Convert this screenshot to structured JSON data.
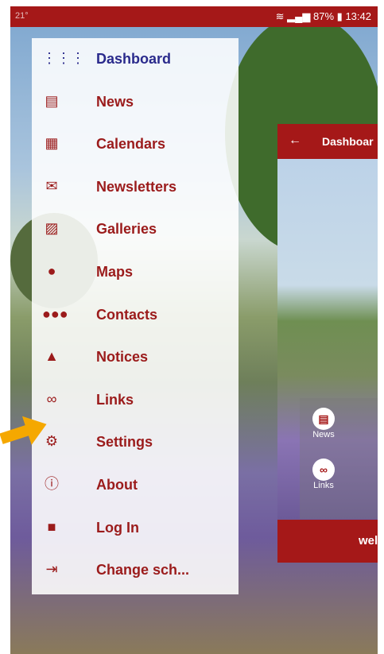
{
  "status": {
    "notification": "21°",
    "signal_battery": "87%",
    "time": "13:42"
  },
  "background_app": {
    "back_label": "←",
    "title": "Dashboar",
    "tile_news": "News",
    "tile_links": "Links",
    "welcome_partial": "wel"
  },
  "drawer": {
    "items": [
      {
        "label": "Dashboard",
        "icon": "dashboard-icon",
        "glyph": "⋮⋮⋮"
      },
      {
        "label": "News",
        "icon": "news-icon",
        "glyph": "▤"
      },
      {
        "label": "Calendars",
        "icon": "calendar-icon",
        "glyph": "▦"
      },
      {
        "label": "Newsletters",
        "icon": "envelope-icon",
        "glyph": "✉"
      },
      {
        "label": "Galleries",
        "icon": "gallery-icon",
        "glyph": "▨"
      },
      {
        "label": "Maps",
        "icon": "map-pin-icon",
        "glyph": "●"
      },
      {
        "label": "Contacts",
        "icon": "contacts-icon",
        "glyph": "●●●"
      },
      {
        "label": "Notices",
        "icon": "bell-icon",
        "glyph": "▲"
      },
      {
        "label": "Links",
        "icon": "link-icon",
        "glyph": "∞"
      },
      {
        "label": "Settings",
        "icon": "gear-icon",
        "glyph": "⚙"
      },
      {
        "label": "About",
        "icon": "info-icon",
        "glyph": "ⓘ"
      },
      {
        "label": "Log In",
        "icon": "lock-icon",
        "glyph": "■"
      },
      {
        "label": "Change sch...",
        "icon": "sign-in-icon",
        "glyph": "⇥"
      }
    ]
  },
  "colors": {
    "brand": "#a51818",
    "menu_text": "#9b1b1b",
    "active_text": "#2a2a8c",
    "pointer_arrow": "#f5a800"
  }
}
